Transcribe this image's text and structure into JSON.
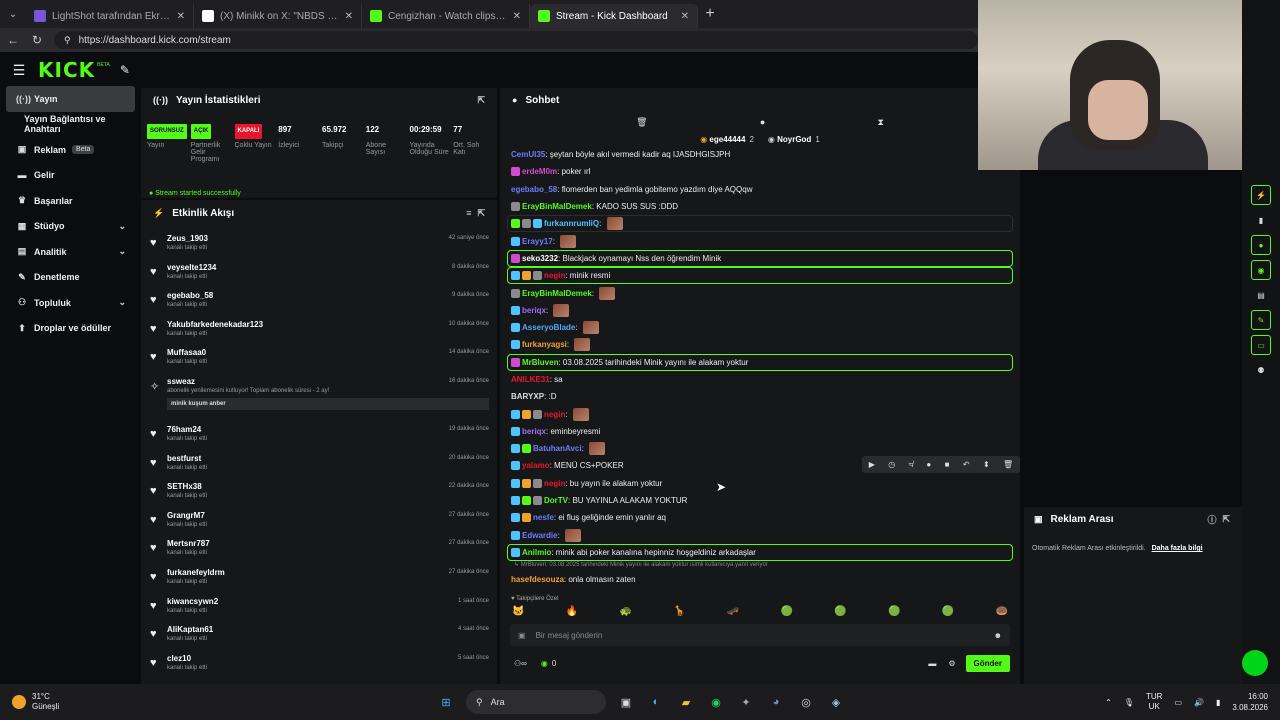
{
  "browser": {
    "tabs": [
      {
        "title": "LightShot tarafından Ekran Görün",
        "fav": "#7a54d8",
        "active": false
      },
      {
        "title": "(X) Minikk on X: \"NBDS İFSA ;) http",
        "fav": "#ffffff",
        "active": false
      },
      {
        "title": "Cengizhan - Watch clips on Kick",
        "fav": "#53fc18",
        "active": false
      },
      {
        "title": "Stream - Kick Dashboard",
        "fav": "#53fc18",
        "active": true
      }
    ],
    "url": "https://dashboard.kick.com/stream"
  },
  "app": {
    "logo": "KICK",
    "logo_beta": "BETA"
  },
  "sidebar": {
    "items": [
      {
        "label": "Yayın",
        "icon": "broadcast-icon",
        "active": true,
        "chev": false,
        "beta": false
      },
      {
        "label": "Yayın Bağlantısı ve Anahtarı",
        "icon": "",
        "active": false,
        "chev": false,
        "beta": false
      },
      {
        "label": "Reklam",
        "icon": "ad-icon",
        "active": false,
        "chev": false,
        "beta": true
      },
      {
        "label": "Gelir",
        "icon": "revenue-icon",
        "active": false,
        "chev": false,
        "beta": false
      },
      {
        "label": "Başarılar",
        "icon": "trophy-icon",
        "active": false,
        "chev": false,
        "beta": false
      },
      {
        "label": "Stüdyo",
        "icon": "studio-icon",
        "active": false,
        "chev": true,
        "beta": false
      },
      {
        "label": "Analitik",
        "icon": "analytics-icon",
        "active": false,
        "chev": true,
        "beta": false
      },
      {
        "label": "Denetleme",
        "icon": "moderation-icon",
        "active": false,
        "chev": false,
        "beta": false
      },
      {
        "label": "Topluluk",
        "icon": "community-icon",
        "active": false,
        "chev": true,
        "beta": false
      },
      {
        "label": "Droplar ve ödüller",
        "icon": "drops-icon",
        "active": false,
        "chev": false,
        "beta": false
      }
    ],
    "beta_label": "Beta"
  },
  "stats": {
    "title": "Yayın İstatistikleri",
    "items": [
      {
        "value": "SORUNSUZ",
        "label": "Yayın",
        "pill": "g"
      },
      {
        "value": "AÇIK",
        "label": "Partnerlik Gelir Programı",
        "pill": "g"
      },
      {
        "value": "KAPALI",
        "label": "Çoklu Yayın",
        "pill": "r"
      },
      {
        "value": "897",
        "label": "İzleyici",
        "pill": ""
      },
      {
        "value": "65.972",
        "label": "Takipçi",
        "pill": ""
      },
      {
        "value": "122",
        "label": "Abone Sayısı",
        "pill": ""
      },
      {
        "value": "00:29:59",
        "label": "Yayında Olduğu Süre",
        "pill": ""
      },
      {
        "value": "77",
        "label": "Ort. Soh Katı",
        "pill": ""
      }
    ],
    "status": "Stream started successfully"
  },
  "activity": {
    "title": "Etkinlik Akışı",
    "rows": [
      {
        "name": "Zeus_1903",
        "sub": "kanalı takip etti",
        "time": "42 saniye önce"
      },
      {
        "name": "veyselte1234",
        "sub": "kanalı takip etti",
        "time": "8 dakika önce"
      },
      {
        "name": "egebabo_58",
        "sub": "kanalı takip etti",
        "time": "9 dakika önce"
      },
      {
        "name": "Yakubfarkedenekadar123",
        "sub": "kanalı takip etti",
        "time": "10 dakika önce"
      },
      {
        "name": "Muffasaa0",
        "sub": "kanalı takip etti",
        "time": "14 dakika önce"
      },
      {
        "name": "ssweaz",
        "sub": "abonelik yenilemesini kutluyor! Toplam abonelik süresi - 2 ay!",
        "time": "16 dakika önce",
        "note": "minik kuşum anber",
        "big": true
      },
      {
        "name": "76ham24",
        "sub": "kanalı takip etti",
        "time": "19 dakika önce"
      },
      {
        "name": "bestfurst",
        "sub": "kanalı takip etti",
        "time": "20 dakika önce"
      },
      {
        "name": "SETHx38",
        "sub": "kanalı takip etti",
        "time": "22 dakika önce"
      },
      {
        "name": "GrangrM7",
        "sub": "kanalı takip etti",
        "time": "27 dakika önce"
      },
      {
        "name": "Mertsnr787",
        "sub": "kanalı takip etti",
        "time": "27 dakika önce"
      },
      {
        "name": "furkanefeyldrm",
        "sub": "kanalı takip etti",
        "time": "27 dakika önce"
      },
      {
        "name": "kiwancsywn2",
        "sub": "kanalı takip etti",
        "time": "1 saat önce"
      },
      {
        "name": "AliKaptan61",
        "sub": "kanalı takip etti",
        "time": "4 saat önce"
      },
      {
        "name": "clez10",
        "sub": "kanalı takip etti",
        "time": "5 saat önce"
      }
    ]
  },
  "chat": {
    "title": "Sohbet",
    "pinned": [
      {
        "name": "ege44444",
        "count": "2"
      },
      {
        "name": "NoyrGod",
        "count": "1"
      }
    ],
    "messages": [
      {
        "user": "CemUl35",
        "color": "#6e7cff",
        "text": "şeytan böyle akıl vermedi kadir aq IJASDHGISJPH",
        "badges": [],
        "style": ""
      },
      {
        "user": "erdeM0m",
        "color": "#d14bd1",
        "text": "poker ırl",
        "badges": [
          "#d14bd1"
        ],
        "style": ""
      },
      {
        "user": "egebabo_58",
        "color": "#6e7cff",
        "text": "flomerden ban yedimla gobitemo yazdım diye AQQqw",
        "badges": [],
        "style": ""
      },
      {
        "user": "ErayBinMalDemek",
        "color": "#53fc18",
        "text": "KADO SUS SUS :DDD",
        "badges": [
          "#8a8a8a"
        ],
        "style": ""
      },
      {
        "user": "furkannrumliQ",
        "color": "#4fc3ff",
        "text": "",
        "badges": [
          "#53fc18",
          "#8a8a8a",
          "#4fc3ff"
        ],
        "style": "dim",
        "emote": true
      },
      {
        "user": "Erayy17",
        "color": "#6e7cff",
        "text": "",
        "badges": [
          "#4fc3ff"
        ],
        "style": "",
        "emote": true
      },
      {
        "user": "seko3232",
        "color": "#ffffff",
        "text": "Blackjack oynamayı Nss den öğrendim Minik",
        "badges": [
          "#d14bd1"
        ],
        "style": "hl"
      },
      {
        "user": "negin",
        "color": "#e8162e",
        "text": "minik resmi",
        "badges": [
          "#4fc3ff",
          "#f0a12a",
          "#8a8a8a"
        ],
        "style": "hl"
      },
      {
        "user": "ErayBinMalDemek",
        "color": "#53fc18",
        "text": "",
        "badges": [
          "#8a8a8a"
        ],
        "style": "",
        "emote": true
      },
      {
        "user": "beriqx",
        "color": "#a06bff",
        "text": "",
        "badges": [
          "#4fc3ff"
        ],
        "style": "",
        "emote": true
      },
      {
        "user": "AsseryoBlade",
        "color": "#4fa8ff",
        "text": "",
        "badges": [
          "#4fc3ff"
        ],
        "style": "",
        "emote": true
      },
      {
        "user": "furkanyagsi",
        "color": "#f0a12a",
        "text": "",
        "badges": [
          "#4fc3ff"
        ],
        "style": "",
        "emote": true
      },
      {
        "user": "MrBluven",
        "color": "#53fc18",
        "text": "03.08.2025 tarihindeki Minik yayını ile alakam yoktur",
        "badges": [
          "#d14bd1"
        ],
        "style": "hl"
      },
      {
        "user": "ANILKE31",
        "color": "#e8162e",
        "text": "sa",
        "badges": [],
        "style": ""
      },
      {
        "user": "BARYXP",
        "color": "#dddddd",
        "text": ":D",
        "badges": [],
        "style": ""
      },
      {
        "user": "negin",
        "color": "#e8162e",
        "text": "",
        "badges": [
          "#4fc3ff",
          "#f0a12a",
          "#8a8a8a"
        ],
        "style": "",
        "emote": true
      },
      {
        "user": "beriqx",
        "color": "#a06bff",
        "text": "eminbeyresmi",
        "badges": [
          "#4fc3ff"
        ],
        "style": ""
      },
      {
        "user": "BatuhanAvci",
        "color": "#6e7cff",
        "text": "",
        "badges": [
          "#4fc3ff",
          "#53fc18"
        ],
        "style": "",
        "emote": true
      },
      {
        "user": "yalamo",
        "color": "#e8162e",
        "text": "MENÜ CS+POKER",
        "badges": [
          "#4fc3ff"
        ],
        "style": ""
      },
      {
        "user": "negin",
        "color": "#e8162e",
        "text": "bu yayın ile alakam yoktur",
        "badges": [
          "#4fc3ff",
          "#f0a12a",
          "#8a8a8a"
        ],
        "style": ""
      },
      {
        "user": "DorTV",
        "color": "#53fc18",
        "text": "BU YAYINLA ALAKAM YOKTUR",
        "badges": [
          "#4fc3ff",
          "#53fc18",
          "#8a8a8a"
        ],
        "style": ""
      },
      {
        "user": "nesfe",
        "color": "#6e7cff",
        "text": "ei fluş geliğinde emin yanlır aq",
        "badges": [
          "#4fc3ff",
          "#f0a12a"
        ],
        "style": ""
      },
      {
        "user": "Edwardie",
        "color": "#6e7cff",
        "text": "",
        "badges": [
          "#4fc3ff"
        ],
        "style": "",
        "emote": true
      },
      {
        "user": "Anilmio",
        "color": "#53fc18",
        "text": "minik abi poker kanalına hepinniz hoşgeldiniz arkadaşlar",
        "badges": [
          "#4fc3ff"
        ],
        "style": "hl"
      }
    ],
    "reply_line": "↳ MrBluven: 03.08.2025 tarihindeki Minik yayını ile alakam yoktur isimli kullanıcıya yanıt veriyor",
    "last": {
      "user": "hasefdesouza",
      "color": "#f0a12a",
      "text": "onla olmasın zaten"
    },
    "sub_only": "♥ Takipçilere Özel",
    "emotes": [
      "🐱",
      "🔥",
      "🐢",
      "🦒",
      "🛹",
      "🟢",
      "🟢",
      "🟢",
      "🟢",
      "🍩"
    ],
    "placeholder": "Bir mesaj gönderin",
    "footer_count": "0",
    "send": "Gönder"
  },
  "ad": {
    "title": "Reklam Arası",
    "text": "Otomatik Reklam Arası etkinleştirildi.",
    "link": "Daha fazla bilgi"
  },
  "taskbar": {
    "temp": "31°C",
    "cond": "Güneşli",
    "search": "Ara",
    "lang1": "TUR",
    "lang2": "UK",
    "time": "16:00",
    "date": "3.08.2026"
  }
}
